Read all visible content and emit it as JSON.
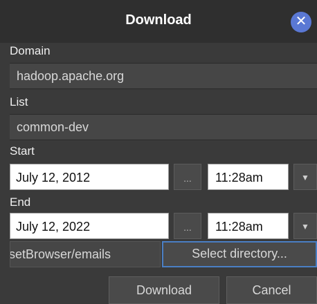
{
  "dialog": {
    "title": "Download",
    "close_glyph": "✕"
  },
  "domain": {
    "label": "Domain",
    "value": "hadoop.apache.org"
  },
  "list": {
    "label": "List",
    "value": "common-dev"
  },
  "start": {
    "label": "Start",
    "date": "July 12, 2012",
    "picker_label": "...",
    "time": "11:28am",
    "time_arrow": "▼"
  },
  "end": {
    "label": "End",
    "date": "July 12, 2022",
    "picker_label": "...",
    "time": "11:28am",
    "time_arrow": "▼"
  },
  "directory": {
    "path": "setBrowser/emails",
    "select_label": "Select directory..."
  },
  "actions": {
    "download_label": "Download",
    "cancel_label": "Cancel"
  },
  "colors": {
    "accent": "#5a78d4",
    "focus": "#4a7fc4",
    "background": "#3a3a3a"
  }
}
